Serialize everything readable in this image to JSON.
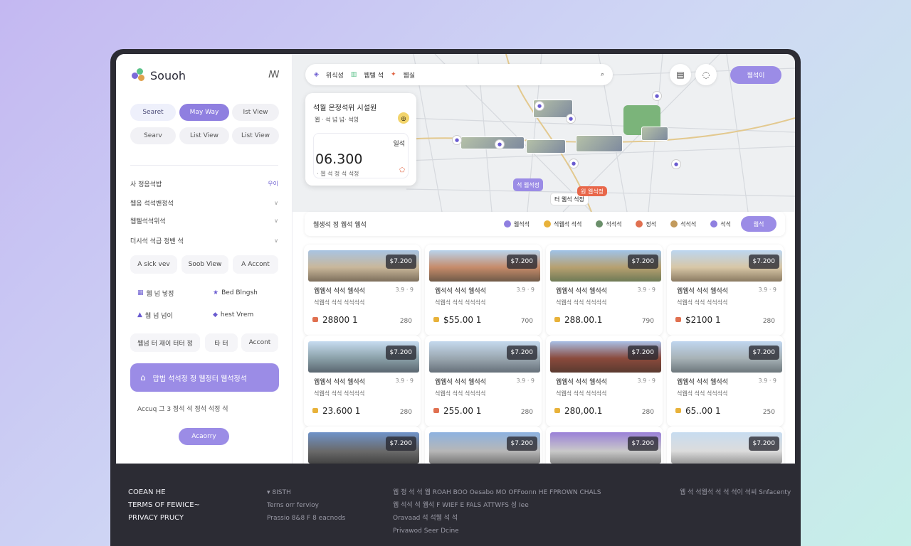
{
  "app": {
    "name": "Souoh",
    "toggle_icon": "ꟿ"
  },
  "sidebar": {
    "pills_row1": [
      "Searet",
      "May Way",
      "Ist View"
    ],
    "pills_row2": [
      "Searv",
      "List View",
      "List View"
    ],
    "section_title": "사 정음석밥",
    "section_badge": "우이",
    "rows": [
      "웹음 석석밴정석",
      "웹텔석석위석",
      "더시석 석급 정밴 석"
    ],
    "chips_row1": [
      "A sick vev",
      "Soob View",
      "A Accont"
    ],
    "chips_row2": [
      "웹 넘 넣정",
      "Bed Blngsh"
    ],
    "chips_row3": [
      "웹 넘 넘이",
      "hest Vrem"
    ],
    "chips_row4": [
      "웹넘 터 재이 터터 정",
      "타 터",
      "Accont"
    ],
    "cta_label": "맙법 석석정 정 웹정터 웹석정석",
    "small_text": "Accuq 그 3 정석 석 정석 석정 석",
    "bottom_button": "Acaorry"
  },
  "map": {
    "search_items": [
      "위식성",
      "웹텔 석",
      "웹실"
    ],
    "top_button": "웹석이",
    "price_card": {
      "title": "석월 온정석위 시설원",
      "sub": "웹 · 석 넘 넘· 석잉",
      "amount": "06.300",
      "value": "일석",
      "mini": "· 웹 석 정 석 석정"
    },
    "markers": [
      "석 웹석정",
      "터 웹석 석정",
      "원 웹석정"
    ]
  },
  "filter": {
    "title": "웹생석 정 웹석 웹석",
    "items": [
      "웹석석",
      "석웹석 석석",
      "석석석",
      "정석",
      "석석석",
      "석석"
    ],
    "button": "웹석"
  },
  "listings": [
    {
      "price": "$7.200",
      "name": "웹웹석 석석 웹석석",
      "meta": "3.9 · 9",
      "desc": "석웹석 석석 석석석석",
      "amount": "28800 1",
      "num": "280",
      "dot": "#e07050"
    },
    {
      "price": "$7.200",
      "name": "웹석석 석석 웹석석",
      "meta": "3.9 · 9",
      "desc": "석웹석 석석 석석석석",
      "amount": "$55.00 1",
      "num": "700",
      "dot": "#e8b23a"
    },
    {
      "price": "$7.200",
      "name": "웹웹석 석석 웹석석",
      "meta": "3.9 · 9",
      "desc": "석웹석 석석 석석석석",
      "amount": "288.00.1",
      "num": "790",
      "dot": "#e8b23a"
    },
    {
      "price": "$7.200",
      "name": "웹웹석 석석 웹석석",
      "meta": "3.9 · 9",
      "desc": "석웹석 석석 석석석석",
      "amount": "$2100 1",
      "num": "280",
      "dot": "#e07050"
    },
    {
      "price": "$7.200",
      "name": "웹웹석 석석 웹석석",
      "meta": "3.9 · 9",
      "desc": "석웹석 석석 석석석석",
      "amount": "23.600 1",
      "num": "280",
      "dot": "#e8b23a"
    },
    {
      "price": "$7.200",
      "name": "웹웹석 석석 웹석석",
      "meta": "3.9 · 9",
      "desc": "석웹석 석석 석석석석",
      "amount": "255.00 1",
      "num": "280",
      "dot": "#e07050"
    },
    {
      "price": "$7.200",
      "name": "웹웹석 석석 웹석석",
      "meta": "3.9 · 9",
      "desc": "석웹석 석석 석석석석",
      "amount": "280,00.1",
      "num": "280",
      "dot": "#e8b23a"
    },
    {
      "price": "$7.200",
      "name": "웹웹석 석석 웹석석",
      "meta": "3.9 · 9",
      "desc": "석웹석 석석 석석석석",
      "amount": "65..00 1",
      "num": "250",
      "dot": "#e8b23a"
    },
    {
      "price": "$7.200"
    },
    {
      "price": "$7.200"
    },
    {
      "price": "$7.200"
    },
    {
      "price": "$7.200"
    }
  ],
  "footer": {
    "col1": [
      "COEAN HE",
      "TERMS OF FEWICE~",
      "PRIVACY PRUCY"
    ],
    "col2_heading": "▾ 8ISTH",
    "col2": [
      "Terns orr fervioy",
      "Prassio 8&8 F 8 eacnods"
    ],
    "col3": [
      "웹 정 석 석 웹 ROAH BOO Oesabo MO OFFoonn HE FPROWN CHALS",
      "웹 석석 석 웹석 F WIEF E FALS ATTWFS 성 Iee",
      "Oravaad 석 석웹 석 석",
      "Privawod Seer Dcine"
    ],
    "col4": "웹 석 석웹석 석 석 석이 석씨 Snfacenty"
  },
  "colors": {
    "accent": "#9b8ce6",
    "dark": "#2c2c34",
    "sidebar_active": "#8f7fe0"
  }
}
